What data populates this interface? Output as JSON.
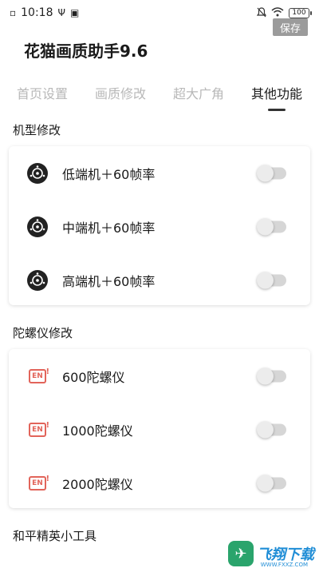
{
  "status_bar": {
    "time": "10:18",
    "battery": "100",
    "left_icons": [
      "sim-icon",
      "usb-icon",
      "notification-icon"
    ],
    "right_icons": [
      "mute-icon",
      "wifi-icon",
      "battery-icon"
    ]
  },
  "header": {
    "title": "花猫画质助手9.6",
    "save_label": "保存"
  },
  "tabs": [
    {
      "label": "首页设置",
      "active": false
    },
    {
      "label": "画质修改",
      "active": false
    },
    {
      "label": "超大广角",
      "active": false
    },
    {
      "label": "其他功能",
      "active": true
    }
  ],
  "sections": [
    {
      "title": "机型修改",
      "items": [
        {
          "label": "低端机＋60帧率",
          "icon": "camera-lens-icon",
          "enabled": false
        },
        {
          "label": "中端机＋60帧率",
          "icon": "camera-lens-icon",
          "enabled": false
        },
        {
          "label": "高端机＋60帧率",
          "icon": "camera-lens-icon",
          "enabled": false
        }
      ]
    },
    {
      "title": "陀螺仪修改",
      "items": [
        {
          "label": "600陀螺仪",
          "icon": "en-badge-icon",
          "enabled": false
        },
        {
          "label": "1000陀螺仪",
          "icon": "en-badge-icon",
          "enabled": false
        },
        {
          "label": "2000陀螺仪",
          "icon": "en-badge-icon",
          "enabled": false
        }
      ]
    },
    {
      "title": "和平精英小工具"
    }
  ],
  "en_icon_text": "EN",
  "watermark": {
    "text": "飞翔下载",
    "subtext": "WWW.FXXZ.COM",
    "colors": {
      "logo": "#2aa46c",
      "text": "#1f8dd6"
    }
  },
  "colors": {
    "save_button_bg": "#9b9b9b",
    "tab_inactive": "#b8b8b8",
    "tab_active": "#1a1a1a",
    "toggle_track_off": "#d6d6d6",
    "en_icon": "#e2645a"
  }
}
